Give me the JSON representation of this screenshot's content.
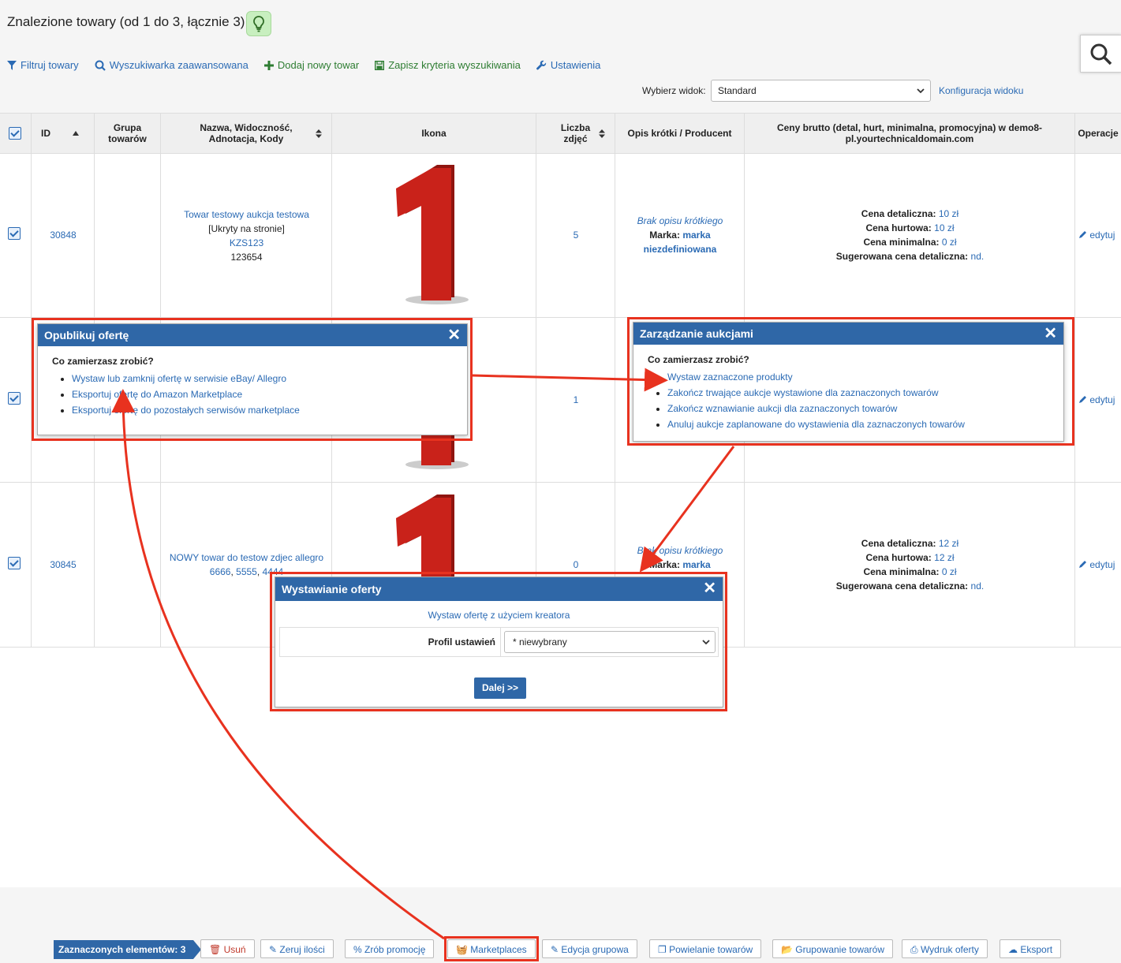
{
  "header": {
    "title": "Znalezione towary (od 1 do 3, łącznie 3)"
  },
  "toolbar": {
    "filter": "Filtruj towary",
    "advanced_search": "Wyszukiwarka zaawansowana",
    "add_new": "Dodaj nowy towar",
    "save_criteria": "Zapisz kryteria wyszukiwania",
    "settings": "Ustawienia"
  },
  "view": {
    "label": "Wybierz widok:",
    "selected": "Standard",
    "config_link": "Konfiguracja widoku"
  },
  "table": {
    "columns": {
      "id": "ID",
      "group_1": "Grupa",
      "group_2": "towarów",
      "name_1": "Nazwa, Widoczność,",
      "name_2": "Adnotacja, Kody",
      "icon": "Ikona",
      "photos_1": "Liczba",
      "photos_2": "zdjęć",
      "desc": "Opis krótki / Producent",
      "prices_1": "Ceny brutto (detal, hurt, minimalna, promocyjna) w demo8-",
      "prices_2": "pl.yourtechnicaldomain.com",
      "ops": "Operacje"
    },
    "rows": [
      {
        "id": "30848",
        "name": "Towar testowy aukcja testowa",
        "visibility": "[Ukryty na stronie]",
        "code": "KZS123",
        "ean": "123654",
        "photos": "5",
        "desc": "Brak opisu krótkiego",
        "brand_label": "Marka:",
        "brand_1": "marka",
        "brand_2": "niezdefiniowana",
        "price_retail_label": "Cena detaliczna:",
        "price_retail": "10 zł",
        "price_wholesale_label": "Cena hurtowa:",
        "price_wholesale": "10 zł",
        "price_min_label": "Cena minimalna:",
        "price_min": "0 zł",
        "price_suggested_label": "Sugerowana cena detaliczna:",
        "price_suggested": "nd.",
        "edit": "edytuj"
      },
      {
        "photos": "1",
        "edit": "edytuj"
      },
      {
        "id": "30845",
        "name": "NOWY towar do testow zdjec allegro",
        "codes_a": "6666",
        "codes_b": "5555",
        "codes_c": "4444",
        "photos": "0",
        "desc": "Brak opisu krótkiego",
        "brand_label": "Marka:",
        "brand_1": "marka",
        "price_retail_label": "Cena detaliczna:",
        "price_retail": "12 zł",
        "price_wholesale_label": "Cena hurtowa:",
        "price_wholesale": "12 zł",
        "price_min_label": "Cena minimalna:",
        "price_min": "0 zł",
        "price_suggested_label": "Sugerowana cena detaliczna:",
        "price_suggested": "nd.",
        "edit": "edytuj"
      }
    ]
  },
  "dialog_publish": {
    "title": "Opublikuj ofertę",
    "question": "Co zamierzasz zrobić?",
    "items": [
      "Wystaw lub zamknij ofertę w serwisie eBay/ Allegro",
      "Eksportuj ofertę do Amazon Marketplace",
      "Eksportuj ofertę do pozostałych serwisów marketplace"
    ]
  },
  "dialog_auctions": {
    "title": "Zarządzanie aukcjami",
    "question": "Co zamierzasz zrobić?",
    "items": [
      "Wystaw zaznaczone produkty",
      "Zakończ trwające aukcje wystawione dla zaznaczonych towarów",
      "Zakończ wznawianie aukcji dla zaznaczonych towarów",
      "Anuluj aukcje zaplanowane do wystawienia dla zaznaczonych towarów"
    ]
  },
  "dialog_offer": {
    "title": "Wystawianie oferty",
    "wizard_link": "Wystaw ofertę z użyciem kreatora",
    "profile_label": "Profil ustawień",
    "profile_value": "* niewybrany",
    "next": "Dalej >>"
  },
  "bottom": {
    "selected": "Zaznaczonych elementów: 3",
    "delete": "Usuń",
    "zero": "Zeruj ilości",
    "promo": "Zrób promocję",
    "marketplaces": "Marketplaces",
    "group_edit": "Edycja grupowa",
    "duplicate": "Powielanie towarów",
    "grouping": "Grupowanie towarów",
    "print": "Wydruk oferty",
    "export": "Eksport"
  },
  "colors": {
    "accent": "#2f67a7",
    "link": "#2a6ab4",
    "highlight": "#e8321f",
    "product_red": "#c9221a"
  }
}
